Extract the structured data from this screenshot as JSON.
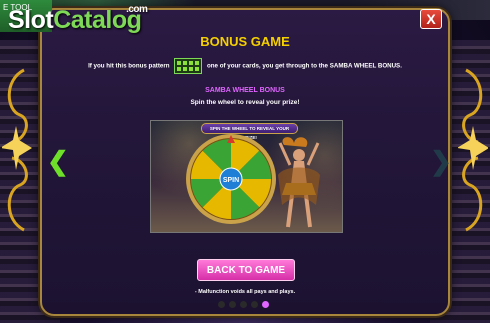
{
  "brand": {
    "slot": "Slot",
    "catalog": "Catalog",
    "com": ".com",
    "free_tool": "E TOOL"
  },
  "dialog": {
    "close_label": "X",
    "title": "BONUS GAME",
    "intro_before": "If you hit this bonus pattern",
    "intro_after": "one of your cards, you get through to the SAMBA WHEEL BONUS.",
    "sub_title": "SAMBA WHEEL BONUS",
    "sub_text": "Spin the wheel to reveal your prize!",
    "preview_banner": "SPIN THE WHEEL TO REVEAL YOUR PRIZE!",
    "wheel_center": "SPIN",
    "back_button": "BACK TO GAME",
    "disclaimer": "- Malfunction voids all pays and plays.",
    "nav_prev": "❮",
    "nav_next": "❯"
  },
  "pager": {
    "pages": 5,
    "active_index": 4
  },
  "colors": {
    "title": "#f5d000",
    "subtitle": "#e066ff",
    "back_button": "#e84fc2",
    "close_button": "#d63a2d",
    "frame": "#a8863c"
  }
}
